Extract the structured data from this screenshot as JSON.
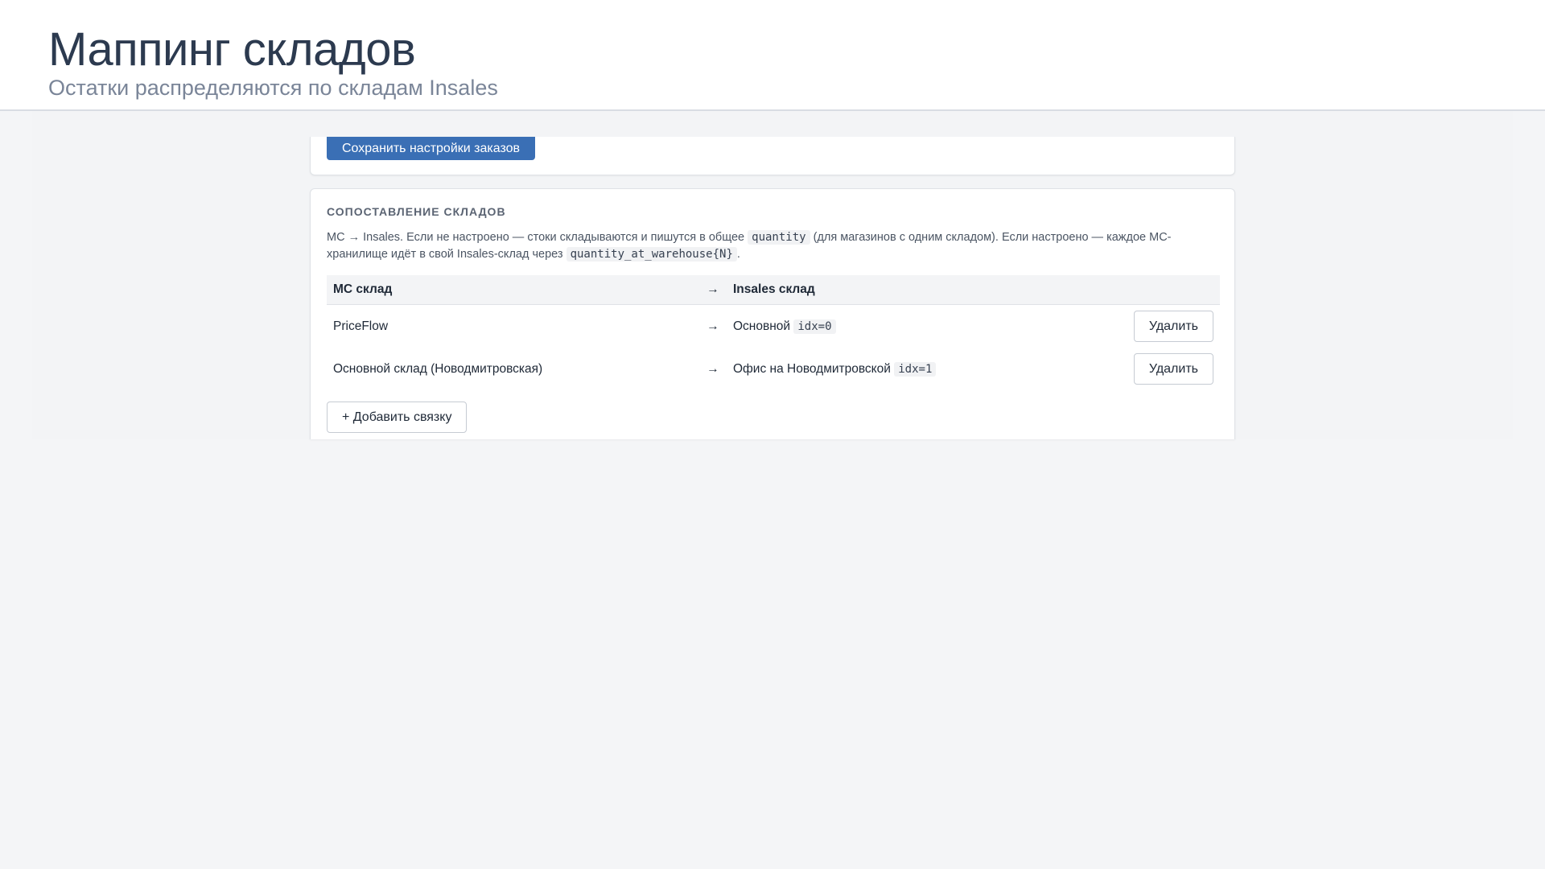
{
  "header": {
    "title": "Маппинг складов",
    "subtitle": "Остатки распределяются по складам Insales"
  },
  "orders_card": {
    "save_label": "Сохранить настройки заказов"
  },
  "mapping": {
    "section_title": "СОПОСТАВЛЕНИЕ СКЛАДОВ",
    "desc_part1": "МС → Insales. Если не настроено — стоки складываются и пишутся в общее",
    "desc_code1": "quantity",
    "desc_part2": "(для магазинов с одним складом). Если настроено — каждое МС-хранилище идёт в свой Insales-склад через",
    "desc_code2": "quantity_at_warehouse{N}",
    "desc_part3": ".",
    "columns": {
      "ms": "МС склад",
      "arrow": "→",
      "insales": "Insales склад"
    },
    "rows": [
      {
        "ms": "PriceFlow",
        "arrow": "→",
        "insales": "Основной",
        "idx": "idx=0",
        "delete_label": "Удалить"
      },
      {
        "ms": "Основной склад (Новодмитровская)",
        "arrow": "→",
        "insales": "Офис на Новодмитровской",
        "idx": "idx=1",
        "delete_label": "Удалить"
      }
    ],
    "add_label": "+ Добавить связку"
  },
  "colors": {
    "primary_button": "#3a6fb5",
    "page_background": "#f4f5f7",
    "title_text": "#2c3a4f"
  }
}
